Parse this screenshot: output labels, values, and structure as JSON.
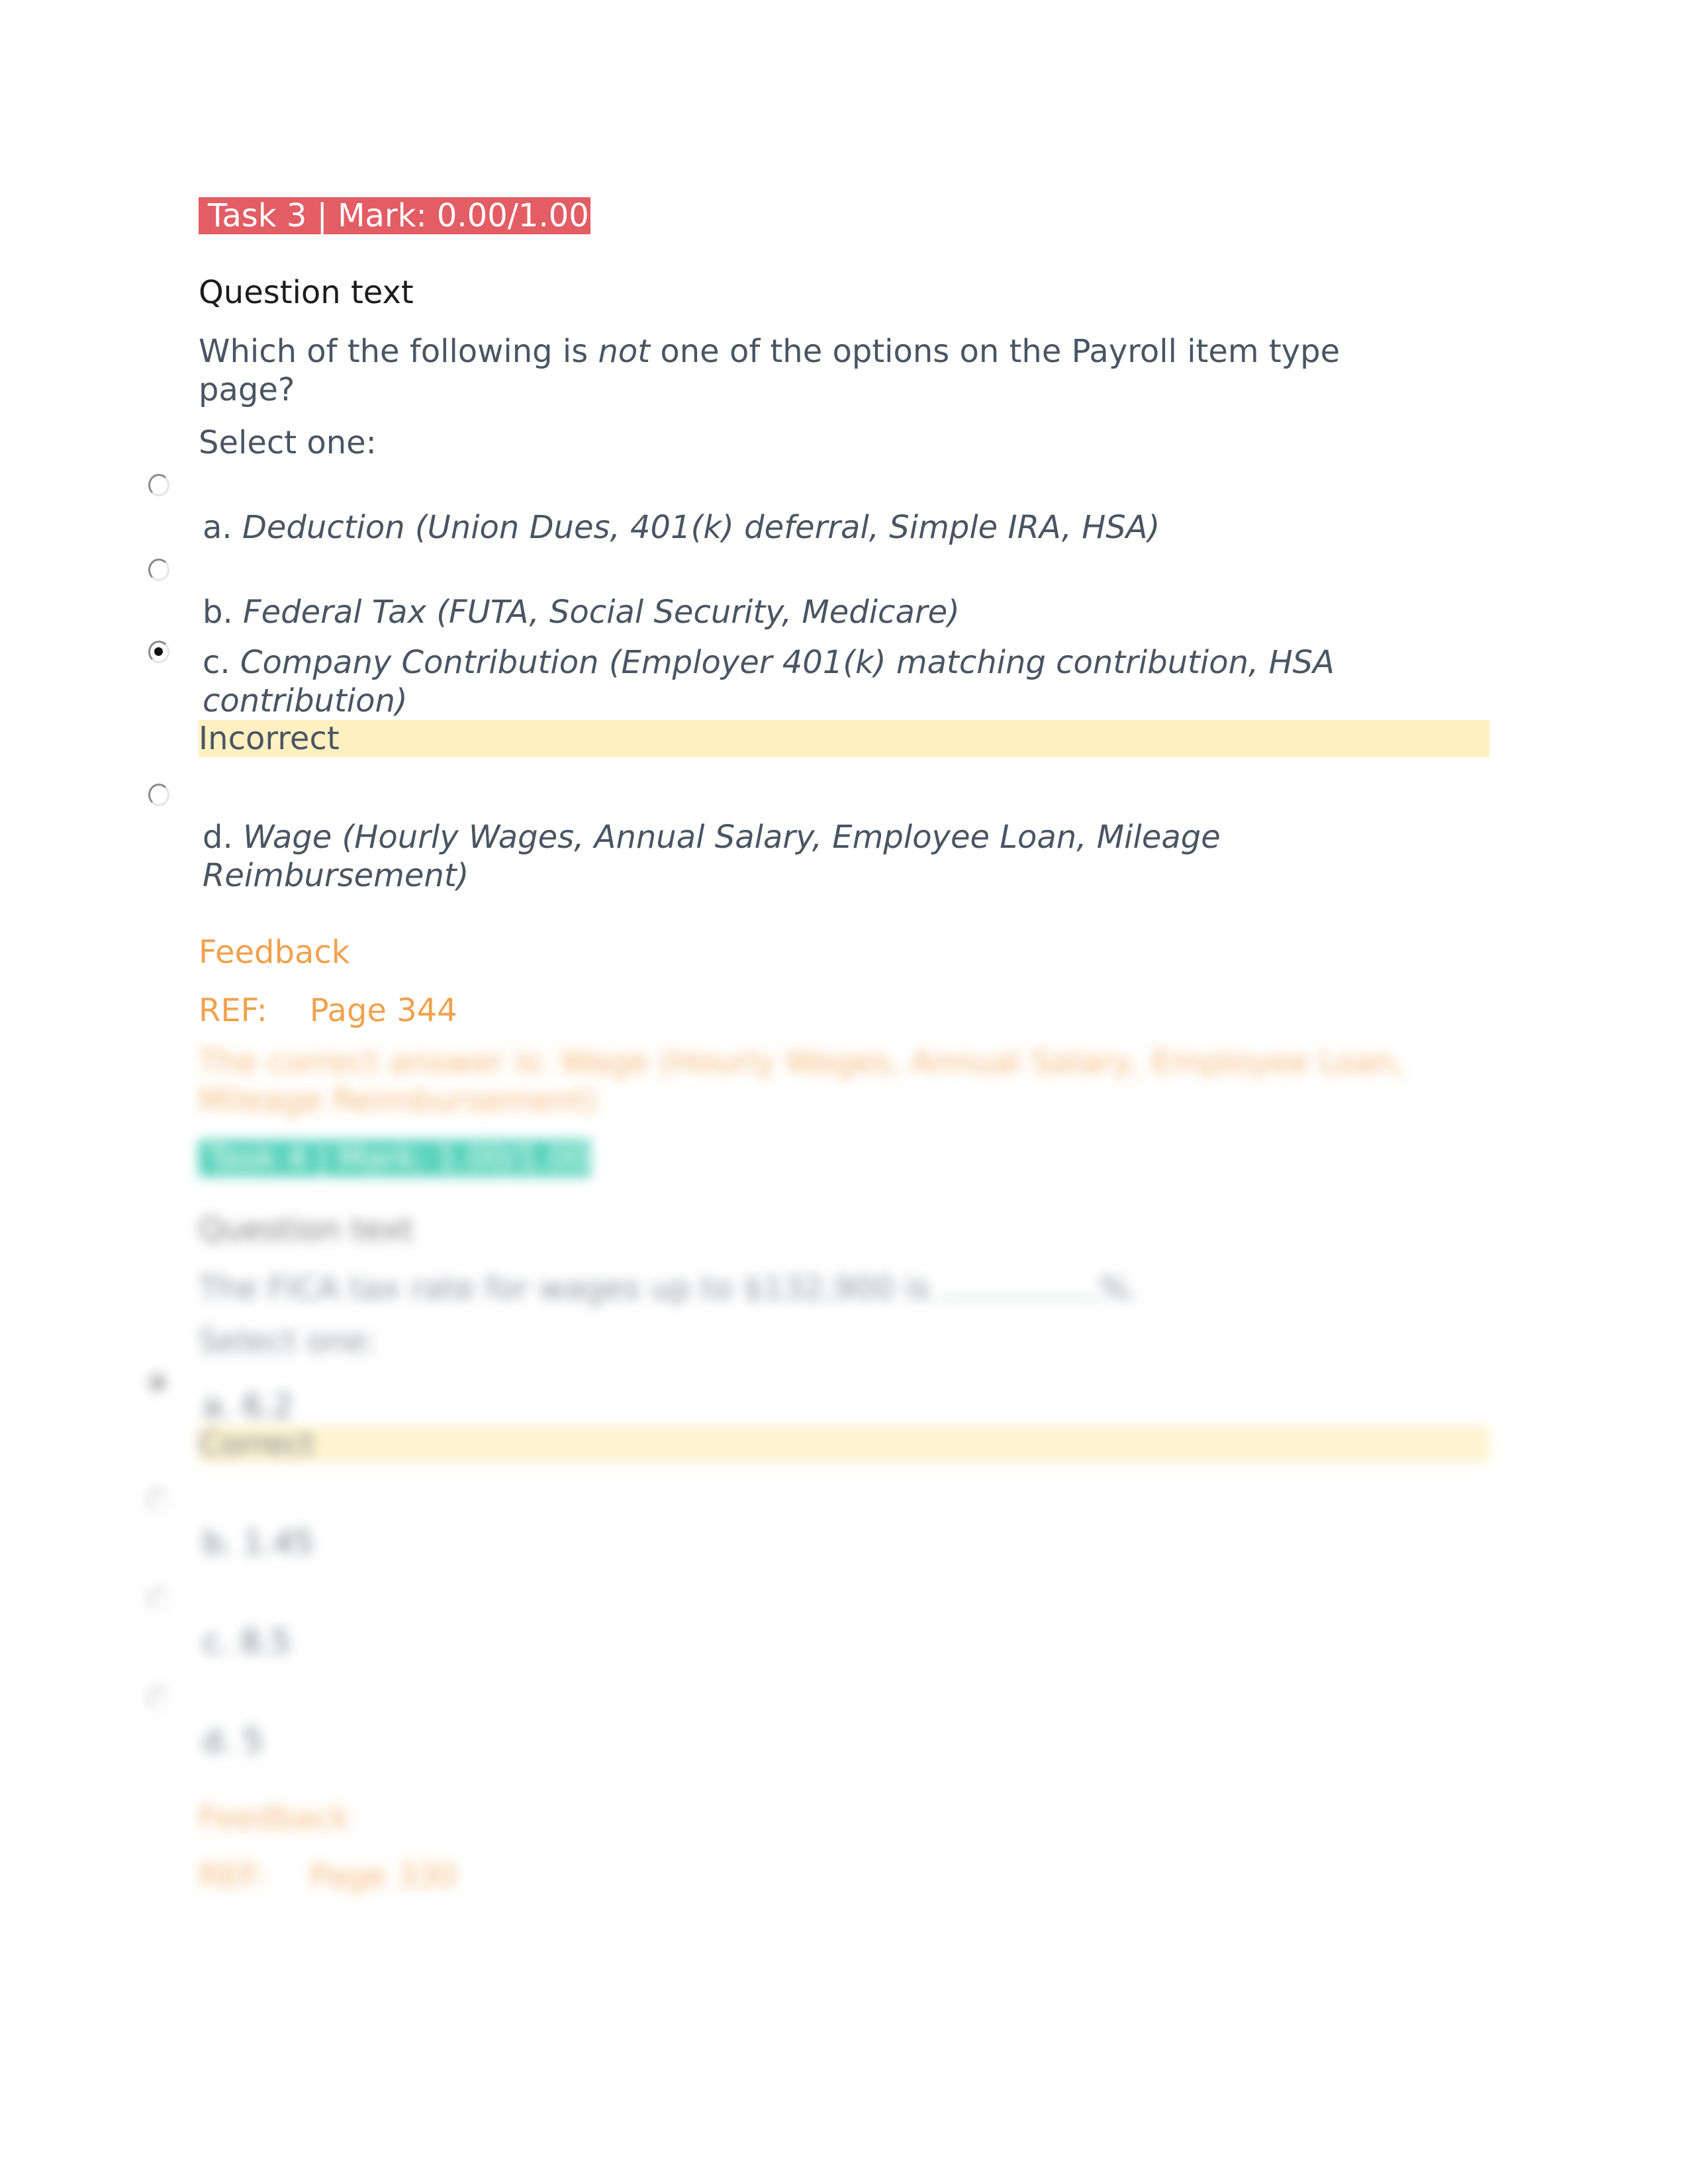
{
  "questions": [
    {
      "badge": "Task 3 | Mark: 0.00/1.00",
      "badge_status": "incorrect",
      "badge_color": "#e35d64",
      "heading": "Question text",
      "text_before": "Which of the following is ",
      "text_emphasis": "not",
      "text_after": " one of the options on the Payroll item type page?",
      "select_label": "Select one:",
      "options": [
        {
          "letter": "a.",
          "text": "Deduction (Union Dues, 401(k) deferral, Simple IRA, HSA)",
          "checked": false
        },
        {
          "letter": "b.",
          "text": "Federal Tax (FUTA, Social Security, Medicare)",
          "checked": false
        },
        {
          "letter": "c.",
          "text": "Company Contribution (Employer 401(k) matching contribution, HSA contribution)",
          "checked": true,
          "status": "Incorrect"
        },
        {
          "letter": "d.",
          "text": "Wage (Hourly Wages, Annual Salary, Employee Loan, Mileage Reimbursement)",
          "checked": false
        }
      ],
      "feedback_title": "Feedback",
      "ref_label": "REF:",
      "ref_value": "Page 344",
      "correct_answer": "The correct answer is: Wage (Hourly Wages, Annual Salary, Employee Loan, Mileage Reimbursement)"
    },
    {
      "badge": "Task 4 | Mark: 1.00/1.00",
      "badge_status": "correct",
      "badge_color": "#20c3a4",
      "heading": "Question text",
      "text_before": "The FICA tax rate for wages up to $132,900 is ",
      "text_after": "%.",
      "select_label": "Select one:",
      "options": [
        {
          "letter": "a.",
          "text": "6.2",
          "checked": true,
          "status": "Correct"
        },
        {
          "letter": "b.",
          "text": "1.45",
          "checked": false
        },
        {
          "letter": "c.",
          "text": "8.5",
          "checked": false
        },
        {
          "letter": "d.",
          "text": "5",
          "checked": false
        }
      ],
      "feedback_title": "Feedback",
      "ref_label": "REF:",
      "ref_value": "Page 330"
    }
  ]
}
